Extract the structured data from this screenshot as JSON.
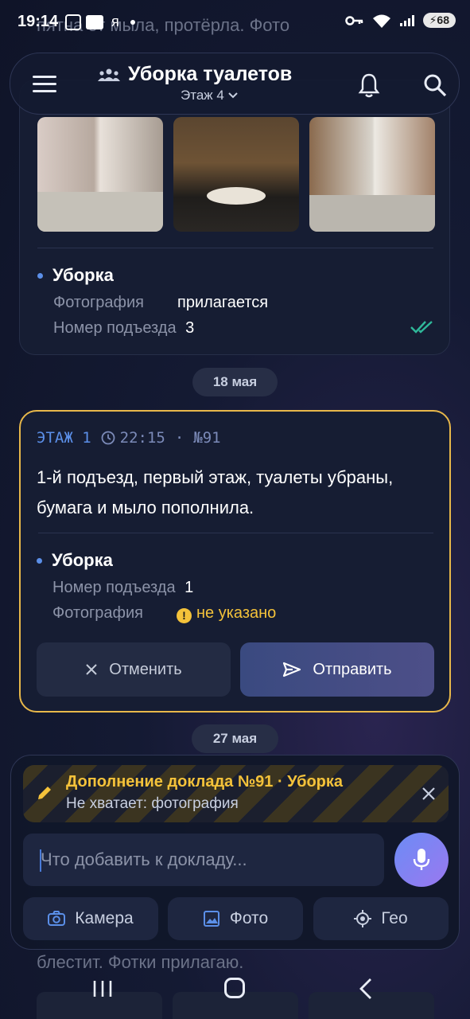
{
  "status_bar": {
    "time": "19:14",
    "carrier_glyph": "я",
    "battery": "68"
  },
  "app_bar": {
    "title": "Уборка туалетов",
    "subtitle": "Этаж 4"
  },
  "background_text": {
    "line1": "пятна от мыла, протёрла. Фото",
    "below_composer": "блестит. Фотки прилагаю."
  },
  "card1": {
    "section_title": "Уборка",
    "fields": [
      {
        "key": "Фотография",
        "value": "прилагается"
      },
      {
        "key": "Номер подъезда",
        "value": "3"
      }
    ]
  },
  "date_chips": {
    "first": "18 мая",
    "second": "27 мая"
  },
  "card2": {
    "floor_label": "ЭТАЖ 1",
    "time": "22:15",
    "separator": "·",
    "number": "№91",
    "text": "1-й подъезд, первый этаж, туалеты убраны, бумага и мыло пополнила.",
    "section_title": "Уборка",
    "fields": [
      {
        "key": "Номер подъезда",
        "value": "1"
      },
      {
        "key": "Фотография",
        "value": "не указано"
      }
    ],
    "cancel_label": "Отменить",
    "send_label": "Отправить"
  },
  "composer": {
    "banner_title": "Дополнение доклада №91 · Уборка",
    "banner_subtitle": "Не хватает: фотография",
    "input_placeholder": "Что добавить к докладу...",
    "input_value": "",
    "quick_actions": [
      {
        "label": "Камера",
        "icon": "camera-icon"
      },
      {
        "label": "Фото",
        "icon": "image-icon"
      },
      {
        "label": "Гео",
        "icon": "location-icon"
      }
    ]
  },
  "colors": {
    "accent_blue": "#5b8fe8",
    "warning_yellow": "#f4c23a",
    "card_border_pending": "#e8b84a",
    "check_green": "#2fb89a"
  }
}
